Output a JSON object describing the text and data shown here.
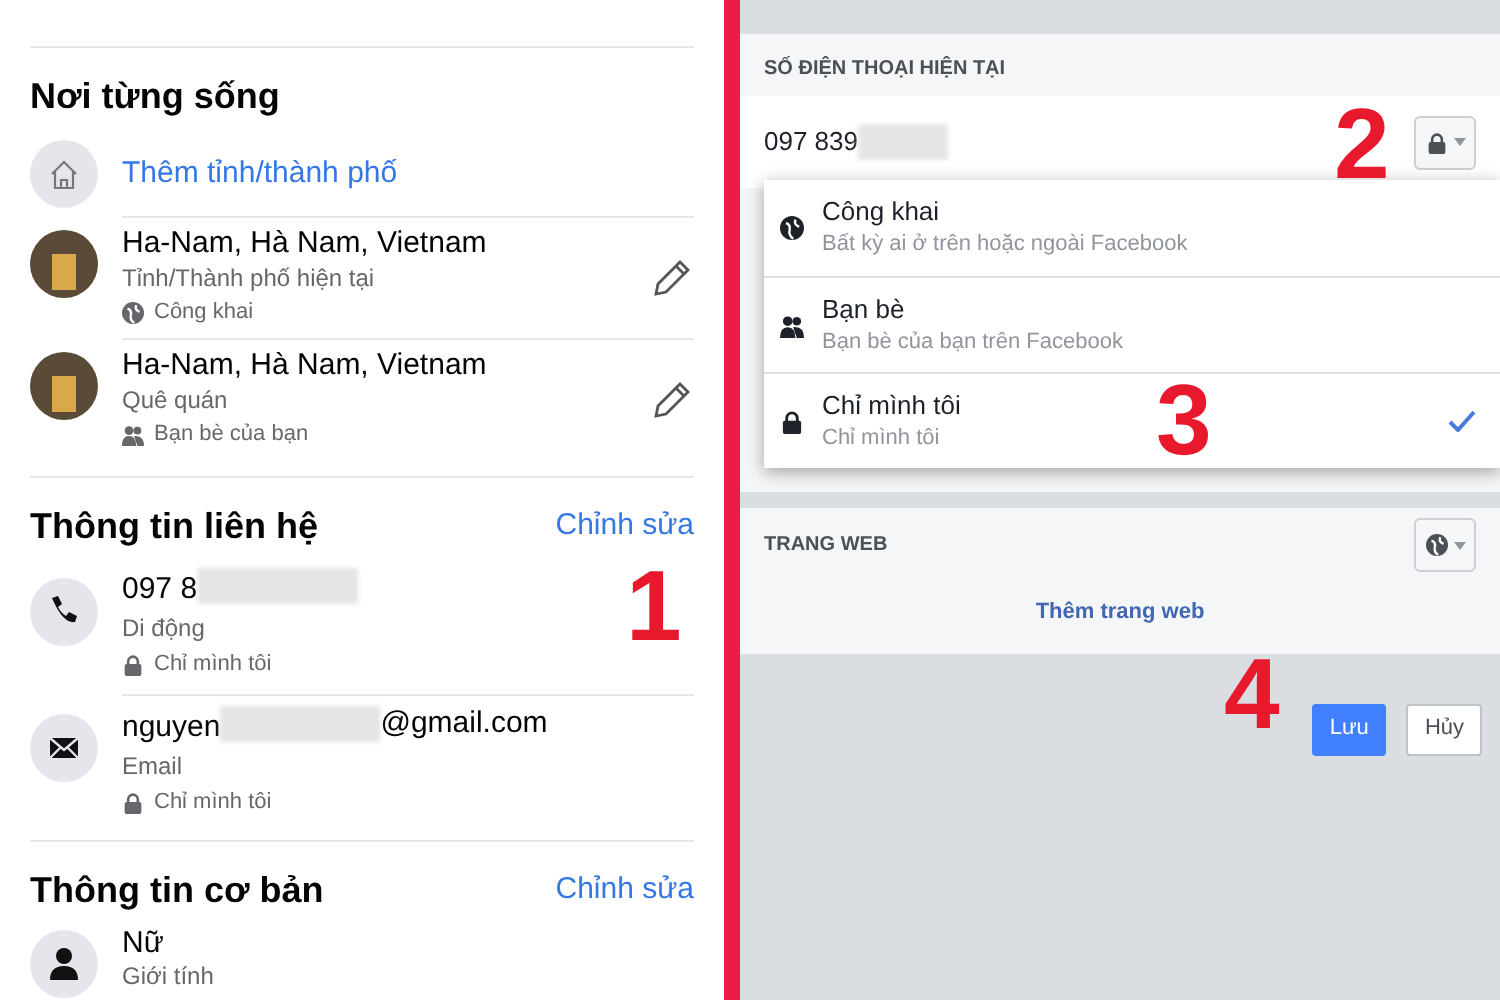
{
  "profile": {
    "places": {
      "title": "Nơi từng sống",
      "add_link": "Thêm tỉnh/thành phố",
      "items": [
        {
          "place": "Ha-Nam, Hà Nam, Vietnam",
          "type": "Tỉnh/Thành phố hiện tại",
          "privacy": {
            "kind": "public",
            "label": "Công khai"
          }
        },
        {
          "place": "Ha-Nam, Hà Nam, Vietnam",
          "type": "Quê quán",
          "privacy": {
            "kind": "friends",
            "label": "Bạn bè của bạn"
          }
        }
      ]
    },
    "contact": {
      "title": "Thông tin liên hệ",
      "edit": "Chỉnh sửa",
      "items": [
        {
          "kind": "phone",
          "value_start": "097 8",
          "type": "Di động",
          "privacy": {
            "kind": "only_me",
            "label": "Chỉ mình tôi"
          }
        },
        {
          "kind": "email",
          "value_start": "nguyen",
          "value_end": "@gmail.com",
          "type": "Email",
          "privacy": {
            "kind": "only_me",
            "label": "Chỉ mình tôi"
          }
        }
      ]
    },
    "basic": {
      "title": "Thông tin cơ bản",
      "edit": "Chỉnh sửa",
      "items": [
        {
          "kind": "gender",
          "value": "Nữ",
          "type": "Giới tính"
        }
      ]
    }
  },
  "edit_panel": {
    "phone_header": "SỐ ĐIỆN THOẠI HIỆN TẠI",
    "phone_value": "097 839",
    "phone_privacy": {
      "kind": "only_me"
    },
    "privacy_menu": {
      "options": [
        {
          "kind": "public",
          "title": "Công khai",
          "description": "Bất kỳ ai ở trên hoặc ngoài Facebook",
          "selected": false
        },
        {
          "kind": "friends",
          "title": "Bạn bè",
          "description": "Bạn bè của bạn trên Facebook",
          "selected": false
        },
        {
          "kind": "only_me",
          "title": "Chỉ mình tôi",
          "description": "Chỉ mình tôi",
          "selected": true
        }
      ]
    },
    "website_header": "TRANG WEB",
    "website_privacy": {
      "kind": "public"
    },
    "add_website": "Thêm trang web",
    "buttons": [
      {
        "kind": "primary",
        "label": "Lưu"
      },
      {
        "kind": "secondary",
        "label": "Hủy"
      }
    ]
  },
  "annotations": [
    "1",
    "2",
    "3",
    "4"
  ]
}
